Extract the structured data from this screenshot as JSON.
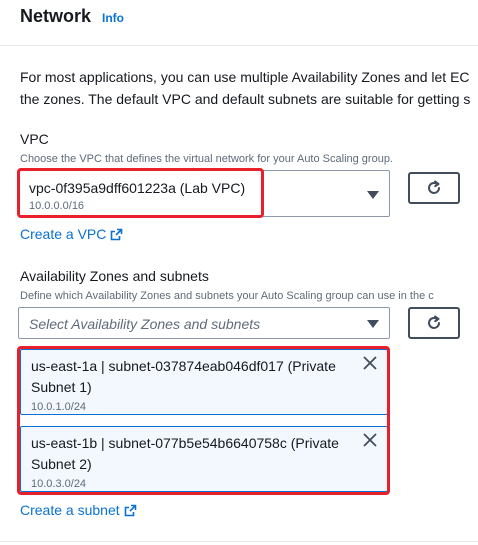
{
  "header": {
    "title": "Network",
    "info_label": "Info"
  },
  "description": {
    "line1": "For most applications, you can use multiple Availability Zones and let EC",
    "line2": "the zones. The default VPC and default subnets are suitable for getting s"
  },
  "vpc": {
    "label": "VPC",
    "hint": "Choose the VPC that defines the virtual network for your Auto Scaling group.",
    "selected_value": "vpc-0f395a9dff601223a (Lab VPC)",
    "selected_cidr": "10.0.0.0/16",
    "create_link": "Create a VPC"
  },
  "availability_zones": {
    "label": "Availability Zones and subnets",
    "hint": "Define which Availability Zones and subnets your Auto Scaling group can use in the c",
    "placeholder": "Select Availability Zones and subnets",
    "selected": [
      {
        "text": "us-east-1a | subnet-037874eab046df017 (Private Subnet 1)",
        "cidr": "10.0.1.0/24"
      },
      {
        "text": "us-east-1b | subnet-077b5e54b6640758c (Private Subnet 2)",
        "cidr": "10.0.3.0/24"
      }
    ],
    "create_link": "Create a subnet"
  },
  "colors": {
    "link": "#0972d3",
    "highlight": "#e8202b",
    "token_bg": "#f2f8fd"
  }
}
